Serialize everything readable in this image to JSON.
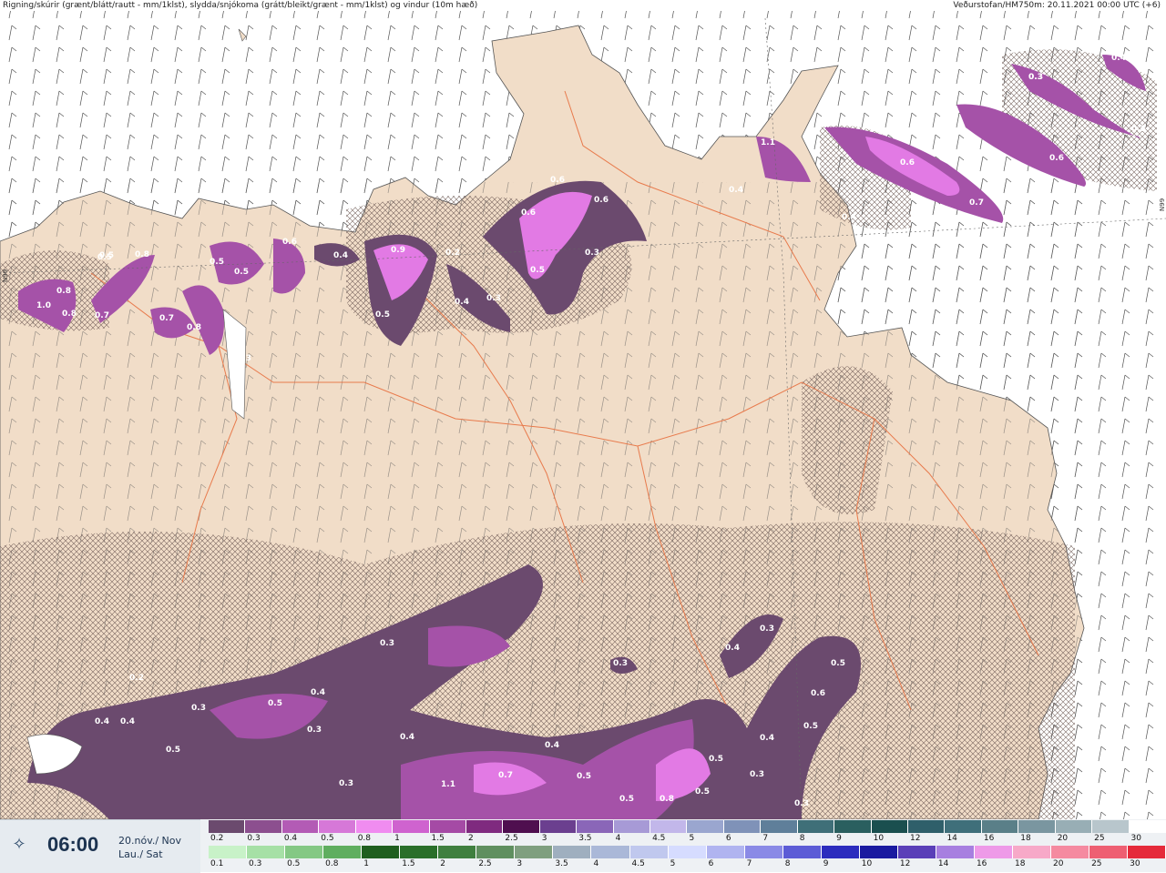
{
  "header": {
    "left_title": "Rigning/skúrir (grænt/blátt/rautt - mm/1klst), slydda/snjókoma (grátt/bleikt/grænt - mm/1klst) og vindur (10m hæð)",
    "right_title": "Veðurstofan/HM750m: 20.11.2021 00:00 UTC (+6)"
  },
  "grid_labels": {
    "left": "N99",
    "right": "N99"
  },
  "clock": {
    "icon": "compass-star-icon",
    "time": "06:00",
    "date_is": "20.nóv./ Nov",
    "day_is": "Lau./ Sat"
  },
  "legend_snow": {
    "labels": [
      "0.2",
      "0.3",
      "0.4",
      "0.5",
      "0.8",
      "1",
      "1.5",
      "2",
      "2.5",
      "3",
      "3.5",
      "4",
      "4.5",
      "5",
      "6",
      "7",
      "8",
      "9",
      "10",
      "12",
      "14",
      "16",
      "18",
      "20",
      "25",
      "30"
    ],
    "colors": [
      "#6b4a6e",
      "#8c4f8f",
      "#b35bb5",
      "#d678d8",
      "#f08cf0",
      "#cf63cf",
      "#a54aa5",
      "#7f2a7f",
      "#4f0f4f",
      "#6b3f8f",
      "#8a66b8",
      "#a79ad6",
      "#c2b7ea",
      "#9aa6cf",
      "#7f92b8",
      "#5f7f9a",
      "#3f6f78",
      "#2a5f5f",
      "#1a4f4f",
      "#2f5f6a",
      "#3f6f7a",
      "#5a7f88",
      "#7a96a0",
      "#98aeb5",
      "#b8c6cc",
      "#ffffff"
    ]
  },
  "legend_rain": {
    "labels": [
      "0.1",
      "0.3",
      "0.5",
      "0.8",
      "1",
      "1.5",
      "2",
      "2.5",
      "3",
      "3.5",
      "4",
      "4.5",
      "5",
      "6",
      "7",
      "8",
      "9",
      "10",
      "12",
      "14",
      "16",
      "18",
      "20",
      "25",
      "30"
    ],
    "colors": [
      "#c8f2c8",
      "#a6e0a6",
      "#84c884",
      "#5fae5f",
      "#1f5f1f",
      "#2a6f2a",
      "#3f7f3f",
      "#5f8f5f",
      "#7f9f7f",
      "#9fafbf",
      "#aab8d8",
      "#c0c8ee",
      "#d6dcff",
      "#b0b4f0",
      "#8a8ae6",
      "#5c5cd6",
      "#2c2cbe",
      "#1a1aa0",
      "#5a3fb8",
      "#a77fe0",
      "#ee9ae8",
      "#f7a9c8",
      "#f58aa0",
      "#ee5f72",
      "#e52a3a"
    ]
  },
  "precip_labels": [
    {
      "t": "0.6"
    },
    {
      "t": "0.6"
    },
    {
      "t": "0.6"
    },
    {
      "t": "0.5"
    },
    {
      "t": "0.3"
    },
    {
      "t": "0.4"
    },
    {
      "t": "0.3"
    },
    {
      "t": "0.9"
    },
    {
      "t": "0.2"
    },
    {
      "t": "0.4"
    },
    {
      "t": "0.5"
    },
    {
      "t": "0.5"
    },
    {
      "t": "0.5"
    },
    {
      "t": "0.8"
    },
    {
      "t": "0.5"
    },
    {
      "t": "0.6"
    },
    {
      "t": "0.8"
    },
    {
      "t": "0.7"
    },
    {
      "t": "0.7"
    },
    {
      "t": "0.8"
    },
    {
      "t": "1.0"
    },
    {
      "t": "0.8"
    },
    {
      "t": "0.3"
    },
    {
      "t": "0.6"
    },
    {
      "t": "0.7"
    },
    {
      "t": "0.6"
    },
    {
      "t": "0.4"
    },
    {
      "t": "0.3"
    },
    {
      "t": "1.1"
    },
    {
      "t": "0.4"
    },
    {
      "t": "0.4"
    },
    {
      "t": "0.4"
    },
    {
      "t": "0.5"
    },
    {
      "t": "0.3"
    },
    {
      "t": "0.3"
    },
    {
      "t": "0.2"
    },
    {
      "t": "0.3"
    },
    {
      "t": "0.5"
    },
    {
      "t": "0.4"
    },
    {
      "t": "0.4"
    },
    {
      "t": "0.4"
    },
    {
      "t": "0.5"
    },
    {
      "t": "0.3"
    },
    {
      "t": "0.4"
    },
    {
      "t": "1.1"
    },
    {
      "t": "0.3"
    },
    {
      "t": "0.7"
    },
    {
      "t": "0.5"
    },
    {
      "t": "0.4"
    },
    {
      "t": "0.5"
    },
    {
      "t": "0.8"
    },
    {
      "t": "0.5"
    },
    {
      "t": "0.5"
    },
    {
      "t": "0.3"
    },
    {
      "t": "0.4"
    },
    {
      "t": "0.3"
    },
    {
      "t": "0.3"
    },
    {
      "t": "0.4"
    },
    {
      "t": "0.5"
    },
    {
      "t": "0.6"
    },
    {
      "t": "0.5"
    },
    {
      "t": "0.4"
    },
    {
      "t": "0.3"
    },
    {
      "t": "0.3"
    }
  ]
}
